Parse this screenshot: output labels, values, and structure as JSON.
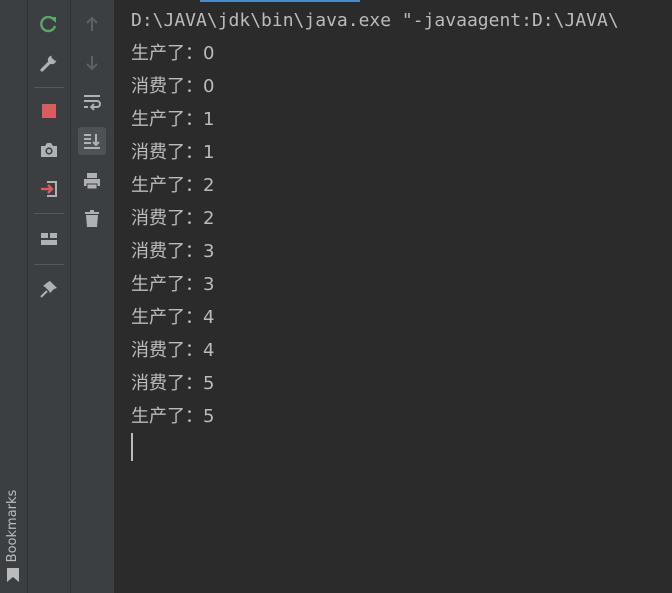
{
  "bookmarks": {
    "label": "Bookmarks"
  },
  "toolbar": {
    "rerun": {
      "icon": "rerun-icon",
      "color": "#59a869"
    },
    "settings": {
      "icon": "wrench-icon"
    },
    "stop": {
      "icon": "stop-icon",
      "color": "#db5c5c"
    },
    "screenshot": {
      "icon": "camera-icon"
    },
    "login": {
      "icon": "login-icon",
      "color": "#db5c5c"
    },
    "layout": {
      "icon": "layout-icon"
    },
    "pin": {
      "icon": "pin-icon"
    }
  },
  "console_toolbar": {
    "up": {
      "icon": "arrow-up-icon"
    },
    "down": {
      "icon": "arrow-down-icon"
    },
    "soft_wrap": {
      "icon": "soft-wrap-icon"
    },
    "scroll_to_end": {
      "icon": "scroll-to-end-icon",
      "active": true
    },
    "print": {
      "icon": "print-icon"
    },
    "clear": {
      "icon": "trash-icon"
    }
  },
  "console": {
    "command": "D:\\JAVA\\jdk\\bin\\java.exe \"-javaagent:D:\\JAVA\\",
    "lines": [
      "生产了：0",
      "消费了：0",
      "生产了：1",
      "消费了：1",
      "生产了：2",
      "消费了：2",
      "消费了：3",
      "生产了：3",
      "生产了：4",
      "消费了：4",
      "消费了：5",
      "生产了：5"
    ]
  }
}
